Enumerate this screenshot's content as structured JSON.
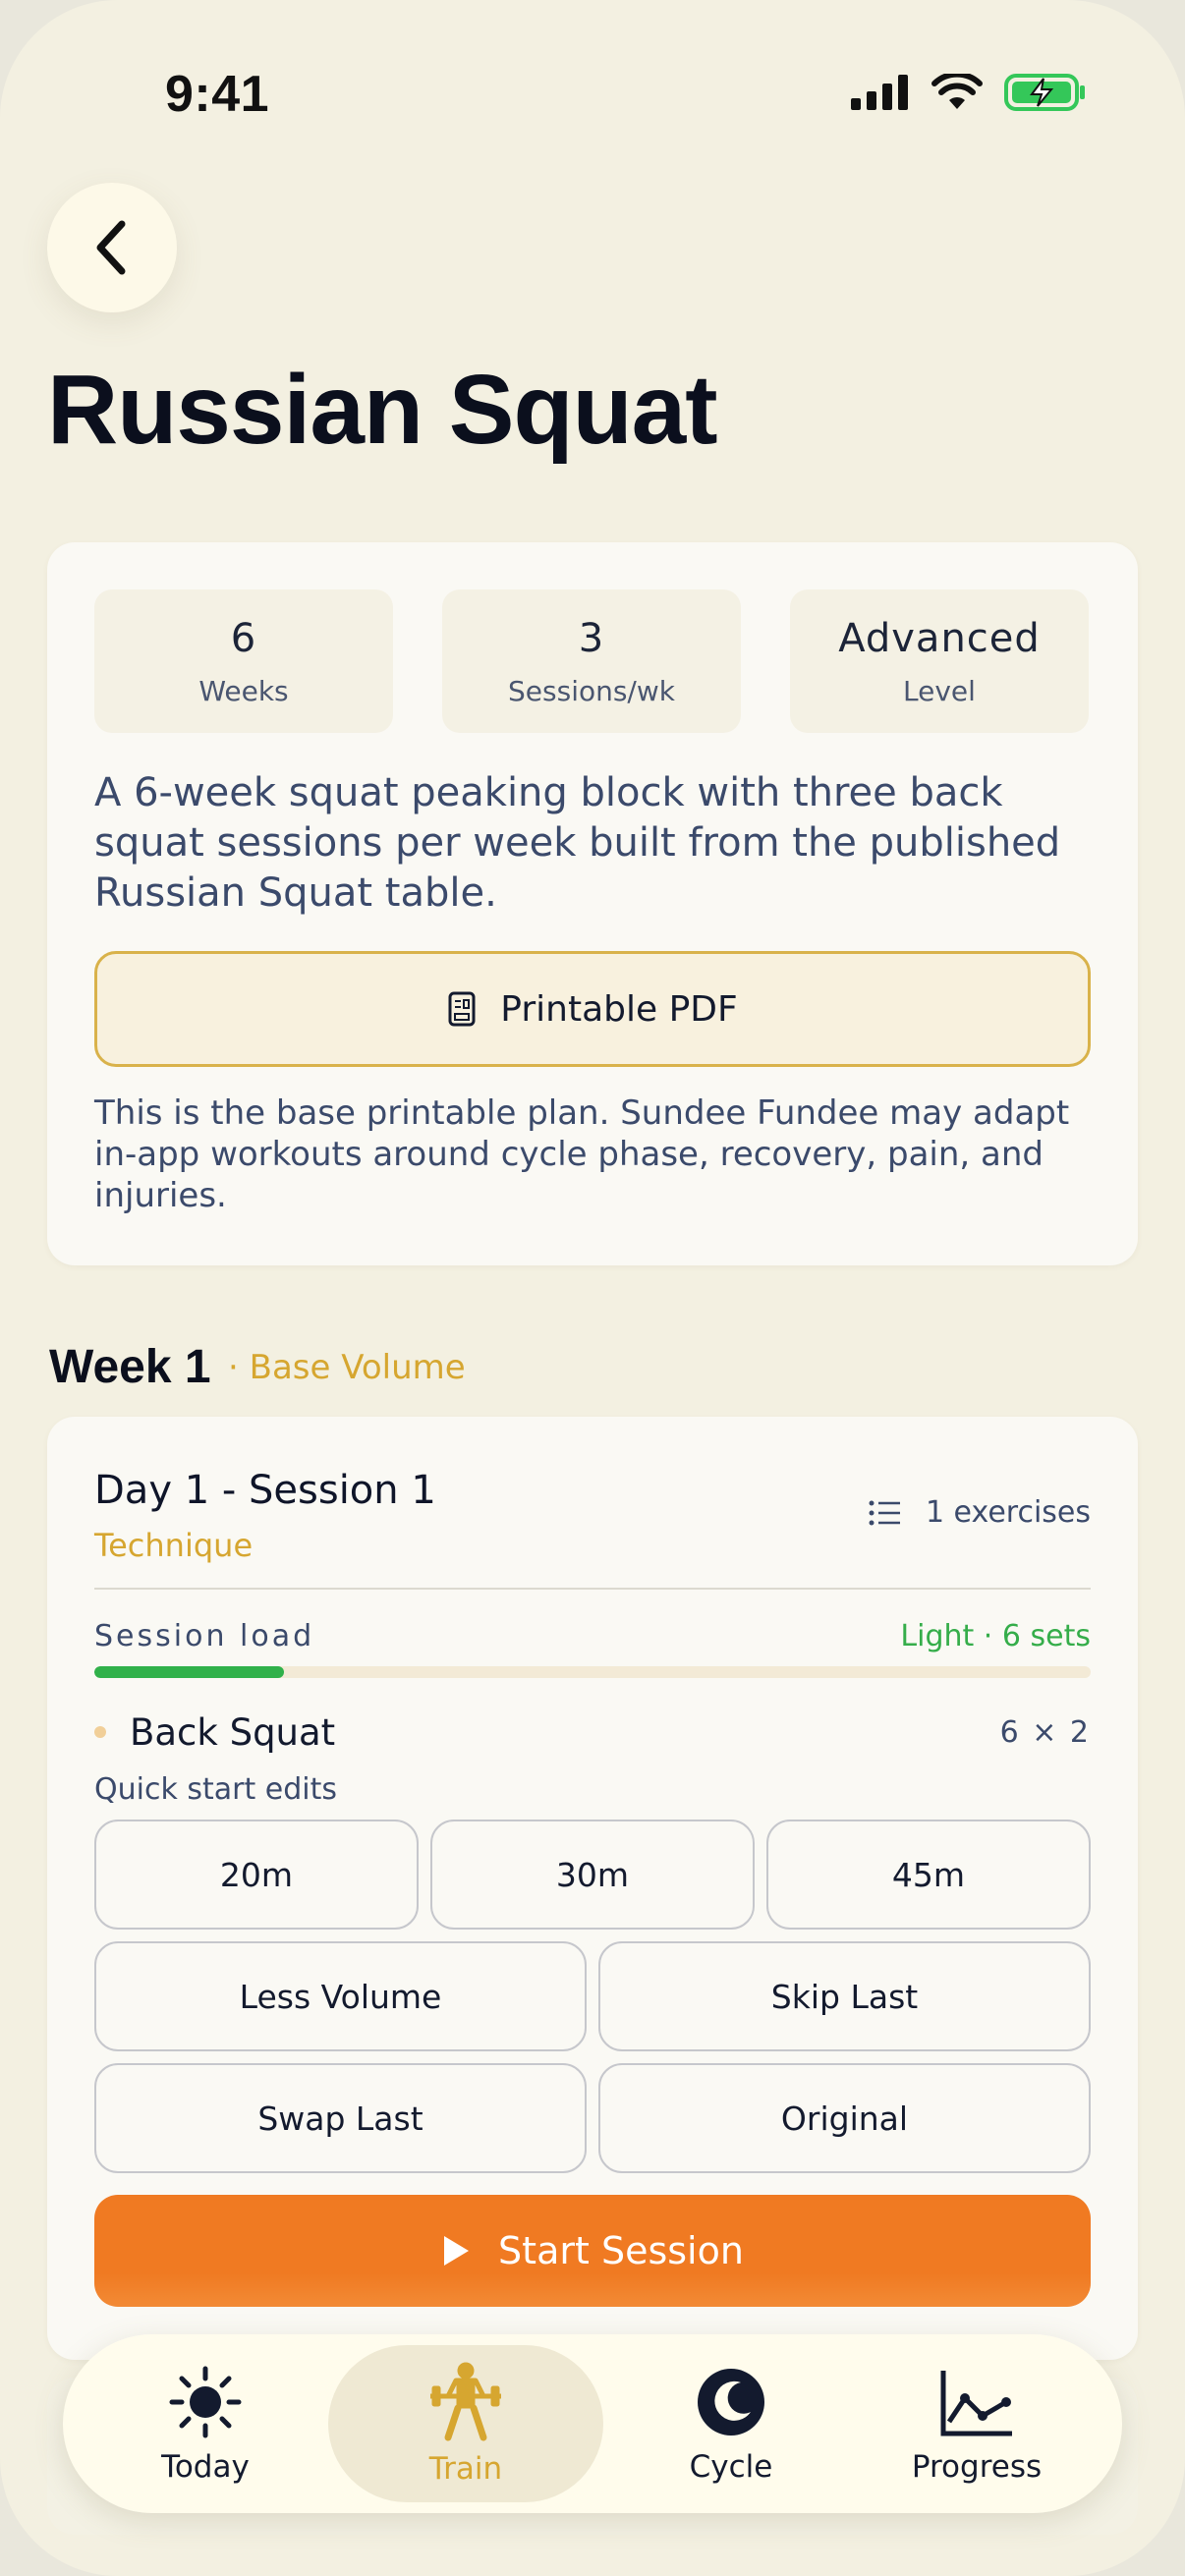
{
  "status": {
    "time": "9:41"
  },
  "header": {
    "title": "Russian Squat"
  },
  "overview": {
    "stats": [
      {
        "value": "6",
        "label": "Weeks"
      },
      {
        "value": "3",
        "label": "Sessions/wk"
      },
      {
        "value": "Advanced",
        "label": "Level"
      }
    ],
    "description": "A 6-week squat peaking block with three back squat sessions per week built from the published Russian Squat table.",
    "pdf_label": "Printable PDF",
    "note": "This is the base printable plan. Sundee Fundee may adapt in-app workouts around cycle phase, recovery, pain, and injuries."
  },
  "week": {
    "title": "Week 1",
    "subtitle": "· Base Volume"
  },
  "session": {
    "title": "Day 1 - Session 1",
    "subtitle": "Technique",
    "exercise_count": "1 exercises",
    "load_label": "Session load",
    "load_value": "Light · 6 sets",
    "load_fraction": 0.19,
    "exercises": [
      {
        "name": "Back Squat",
        "sets": "6 × 2"
      }
    ],
    "quick_label": "Quick start edits",
    "time_chips": [
      "20m",
      "30m",
      "45m"
    ],
    "edit_chips": [
      "Less Volume",
      "Skip Last",
      "Swap Last",
      "Original"
    ],
    "start_label": "Start Session"
  },
  "colors": {
    "accent": "#d6a630",
    "start": "#f07a22",
    "light": "#30b14a",
    "battery": "#34c759"
  },
  "tabs": [
    {
      "label": "Today",
      "icon": "sun-icon"
    },
    {
      "label": "Train",
      "icon": "barbell-lifter-icon",
      "active": true
    },
    {
      "label": "Cycle",
      "icon": "moon-icon"
    },
    {
      "label": "Progress",
      "icon": "chart-line-icon"
    }
  ]
}
